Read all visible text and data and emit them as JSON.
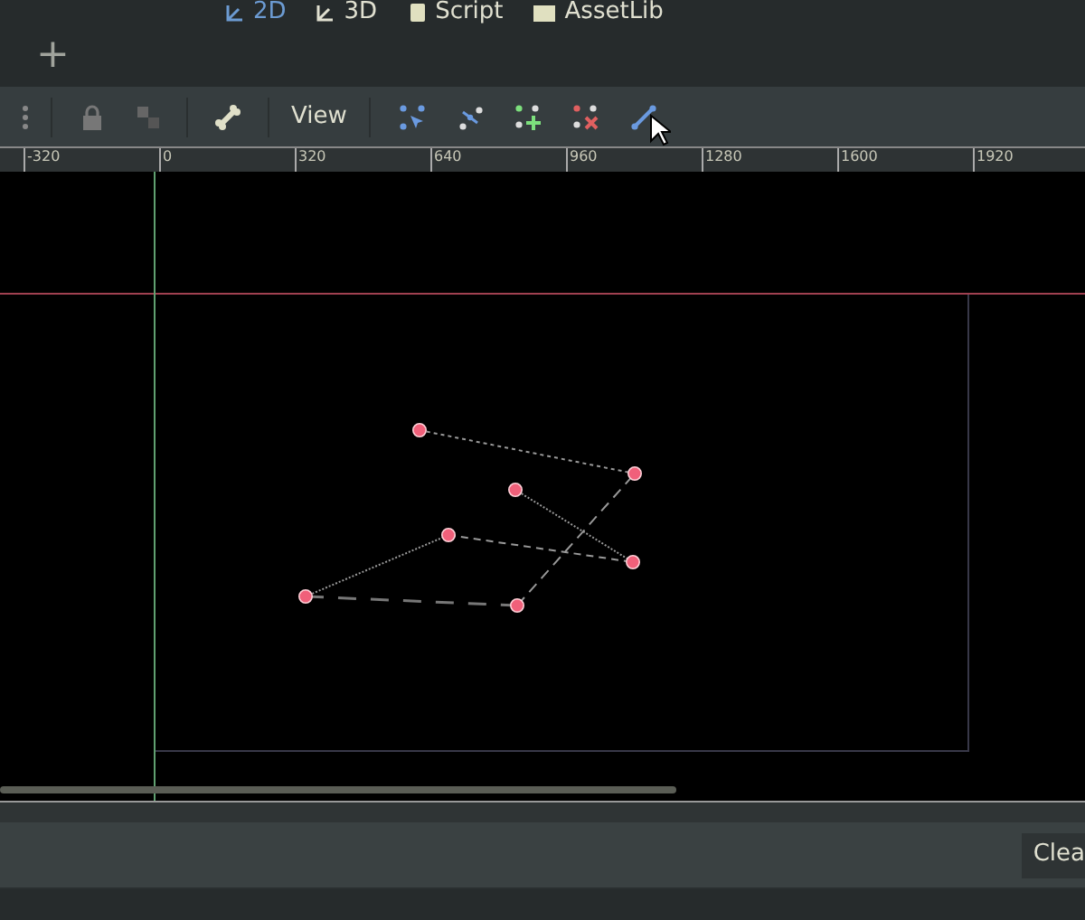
{
  "main_tabs": [
    {
      "label": "2D",
      "selected": true,
      "kind": "twod"
    },
    {
      "label": "3D",
      "selected": false,
      "kind": "threed"
    },
    {
      "label": "Script",
      "selected": false,
      "kind": "script"
    },
    {
      "label": "AssetLib",
      "selected": false,
      "kind": "assetlib"
    }
  ],
  "add_tab": "+",
  "toolbar": {
    "view_menu": "View"
  },
  "ruler": {
    "labels": [
      "-320",
      "0",
      "320",
      "640",
      "960",
      "1280",
      "1600",
      "1920"
    ]
  },
  "bottom_panel": {
    "clear_button": "Clea"
  }
}
